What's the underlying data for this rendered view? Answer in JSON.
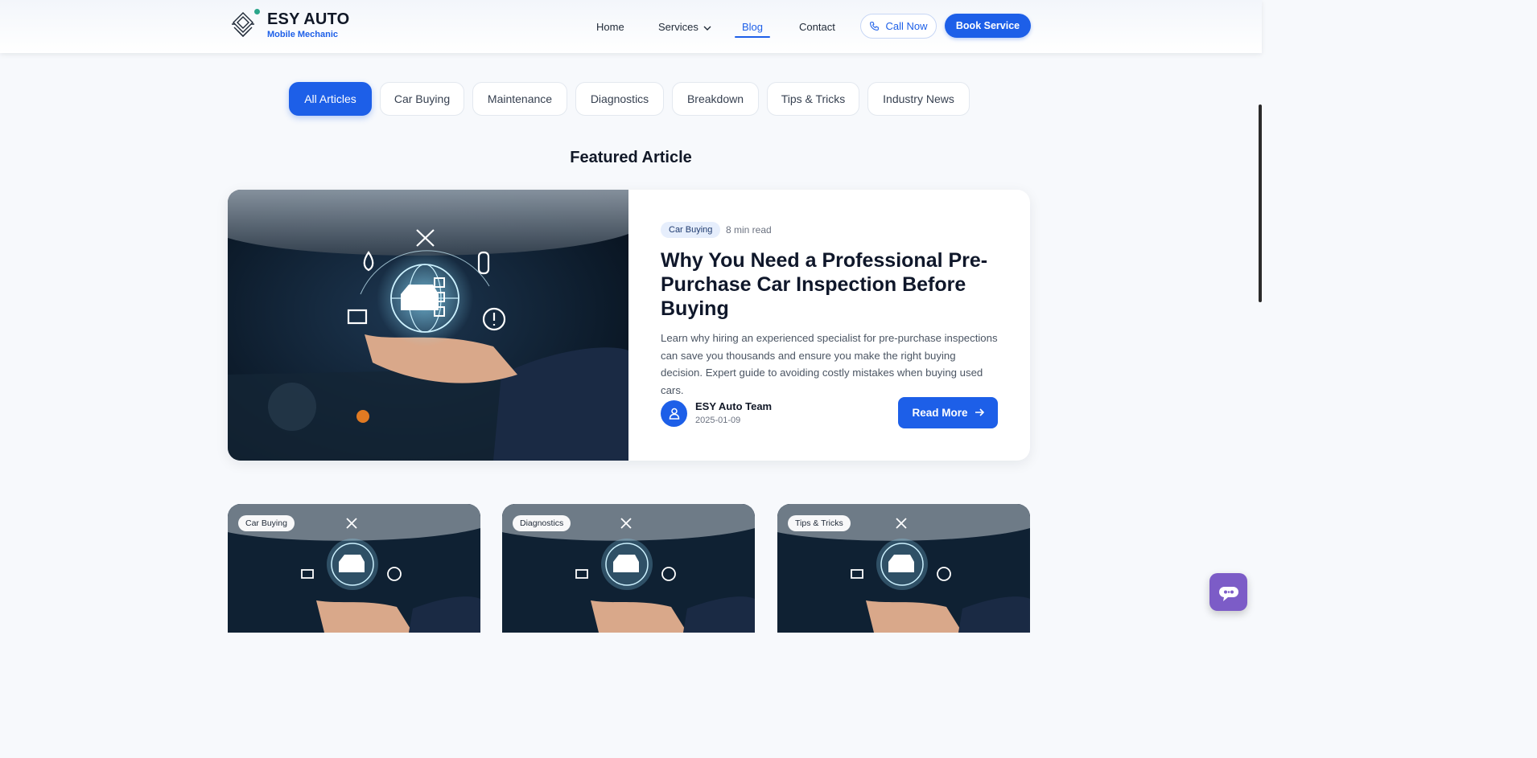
{
  "brand": {
    "title": "ESY AUTO",
    "subtitle": "Mobile Mechanic"
  },
  "nav": {
    "home": "Home",
    "services": "Services",
    "blog": "Blog",
    "contact": "Contact"
  },
  "header_buttons": {
    "call": "Call Now",
    "book": "Book Service"
  },
  "filters": [
    "All Articles",
    "Car Buying",
    "Maintenance",
    "Diagnostics",
    "Breakdown",
    "Tips & Tricks",
    "Industry News"
  ],
  "section_title": "Featured Article",
  "featured": {
    "tag": "Car Buying",
    "read_time": "8 min read",
    "title": "Why You Need a Professional Pre-Purchase Car Inspection Before Buying",
    "description": "Learn why hiring an experienced specialist for pre-purchase inspections can save you thousands and ensure you make the right buying decision. Expert guide to avoiding costly mistakes when buying used cars.",
    "author": "ESY Auto Team",
    "date": "2025-01-09",
    "read_more": "Read More"
  },
  "cards": [
    {
      "tag": "Car Buying"
    },
    {
      "tag": "Diagnostics"
    },
    {
      "tag": "Tips & Tricks"
    }
  ],
  "colors": {
    "accent": "#1d5fe8",
    "chat": "#7c5cc7"
  }
}
